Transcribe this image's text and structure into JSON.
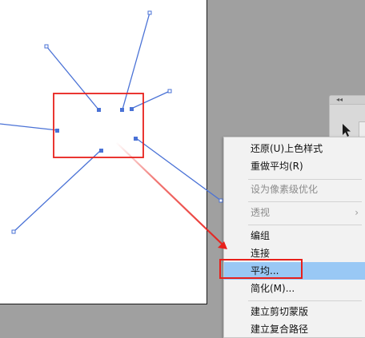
{
  "menu": {
    "items": [
      {
        "label": "还原(U)上色样式",
        "state": "enabled"
      },
      {
        "label": "重做平均(R)",
        "state": "enabled"
      },
      {
        "label": "设为像素级优化",
        "state": "disabled"
      },
      {
        "label": "透视",
        "state": "disabled",
        "submenu_icon": "chevron-right-icon"
      },
      {
        "label": "编组",
        "state": "enabled"
      },
      {
        "label": "连接",
        "state": "enabled"
      },
      {
        "label": "平均...",
        "state": "highlighted"
      },
      {
        "label": "简化(M)...",
        "state": "enabled"
      },
      {
        "label": "建立剪切蒙版",
        "state": "enabled"
      },
      {
        "label": "建立复合路径",
        "state": "enabled"
      }
    ],
    "submenu_glyph": "›"
  },
  "tool_panel": {
    "grip_glyph": "◂◂",
    "tool_icon": "selection-arrow-icon"
  },
  "colors": {
    "path_stroke": "#4a72d6",
    "annotation_red": "#e8201b",
    "highlight": "#99c8f5",
    "workspace": "#a0a0a0"
  }
}
